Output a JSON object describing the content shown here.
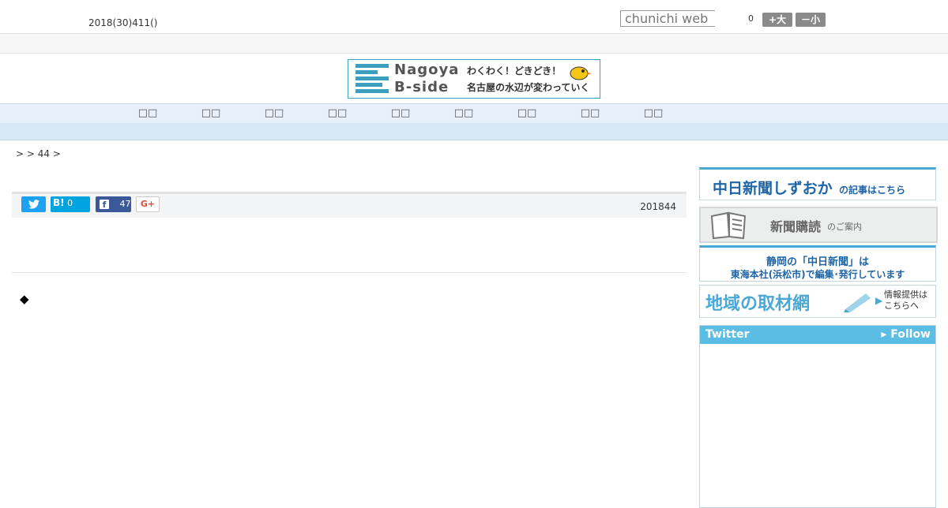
{
  "header": {
    "date_text": "2018(30)411()",
    "search_placeholder": "chunichi web",
    "font_size_value": "0",
    "enlarge_label": "+大",
    "shrink_label": "－小"
  },
  "banner": {
    "title_line1": "Nagoya",
    "title_line2": "B-side",
    "tagline1": "わくわく！どきどき！",
    "tagline2": "名古屋の水辺が変わっていく",
    "accent_color": "#3c9fbd"
  },
  "nav": {
    "items": [
      {
        "label": "□□"
      },
      {
        "label": "□□"
      },
      {
        "label": "□□"
      },
      {
        "label": "□□"
      },
      {
        "label": "□□"
      },
      {
        "label": "□□"
      },
      {
        "label": "□□"
      },
      {
        "label": "□□"
      },
      {
        "label": "□□"
      }
    ]
  },
  "breadcrumb": {
    "text": ">  > 44 >"
  },
  "article": {
    "share": {
      "twitter_icon": "twitter-icon",
      "hatena_label": "B!",
      "hatena_count": "0",
      "facebook_count": "47",
      "gplus_label": "G+"
    },
    "published": "201844",
    "bullet": "◆"
  },
  "sidebar": {
    "banner1_main": "中日新聞しずおか",
    "banner1_sub": "の記事はこちら",
    "banner2_main": "新聞購読",
    "banner2_sub": "のご案内",
    "banner3_line1": "静岡の「中日新聞」は",
    "banner3_line2": "東海本社(浜松市)で編集･発行しています",
    "banner4_main": "地域の取材網",
    "banner4_sub1": "情報提供は",
    "banner4_sub2": "こちらへ",
    "twitter_title": "Twitter",
    "twitter_follow": "▸ Follow",
    "accent_color": "#5bbde4"
  }
}
